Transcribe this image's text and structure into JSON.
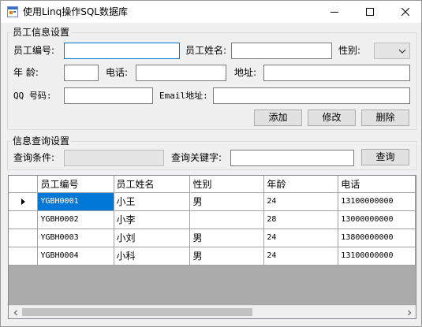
{
  "window": {
    "title": "使用Linq操作SQL数据库",
    "app_icon": "winforms-app-icon",
    "controls": {
      "minimize": "minimize-icon",
      "maximize": "maximize-icon",
      "close": "close-icon"
    }
  },
  "employee_group": {
    "title": "员工信息设置",
    "id_label": "员工编号:",
    "name_label": "员工姓名:",
    "gender_label": "性别:",
    "age_label": "年    龄:",
    "phone_label": "电话:",
    "address_label": "地址:",
    "qq_label": "QQ  号码:",
    "email_label": "Email地址:",
    "id_value": "",
    "name_value": "",
    "gender_value": "",
    "age_value": "",
    "phone_value": "",
    "address_value": "",
    "qq_value": "",
    "email_value": "",
    "add_button": "添加",
    "edit_button": "修改",
    "delete_button": "删除"
  },
  "query_group": {
    "title": "信息查询设置",
    "condition_label": "查询条件:",
    "condition_value": "",
    "keyword_label": "查询关键字:",
    "keyword_value": "",
    "query_button": "查询"
  },
  "grid": {
    "columns": [
      "员工编号",
      "员工姓名",
      "性别",
      "年龄",
      "电话"
    ],
    "rows": [
      [
        "YGBH0001",
        "小王",
        "男",
        "24",
        "13100000000"
      ],
      [
        "YGBH0002",
        "小李",
        "",
        "28",
        "13000000000"
      ],
      [
        "YGBH0003",
        "小刘",
        "男",
        "24",
        "13800000000"
      ],
      [
        "YGBH0004",
        "小科",
        "男",
        "24",
        "13100000000"
      ]
    ],
    "current_row_index": 0,
    "selection_color": "#0078d7"
  }
}
